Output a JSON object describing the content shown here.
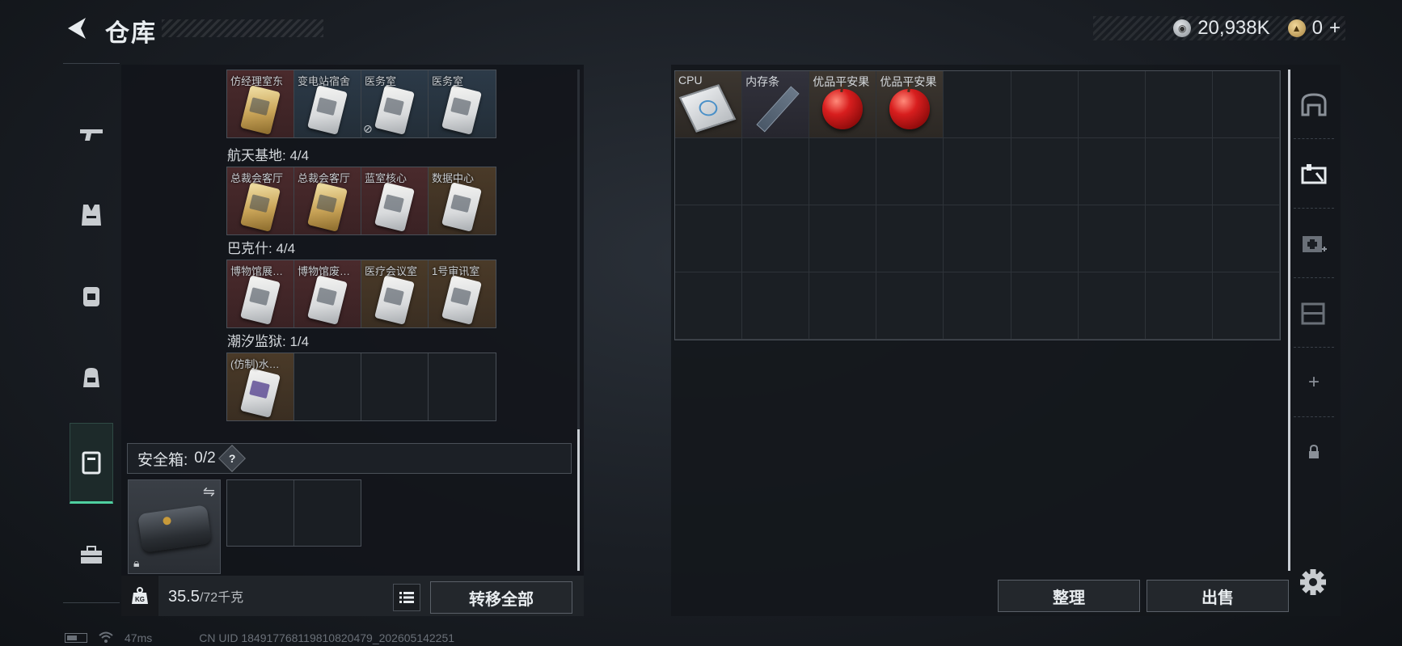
{
  "header": {
    "title": "仓库",
    "currencies": [
      {
        "icon": "silver-coin-icon",
        "value": "20,938K"
      },
      {
        "icon": "gold-coin-icon",
        "value": "0",
        "suffix": "+"
      }
    ]
  },
  "left_nav": [
    {
      "name": "weapon-icon",
      "active": false
    },
    {
      "name": "armor-vest-icon",
      "active": false
    },
    {
      "name": "chest-rig-icon",
      "active": false
    },
    {
      "name": "backpack-icon",
      "active": false
    },
    {
      "name": "safe-box-icon",
      "active": true
    },
    {
      "name": "toolbox-icon",
      "active": false
    }
  ],
  "key_groups": [
    {
      "label": "",
      "cells": [
        {
          "label": "仿经理室东",
          "color": "red",
          "card": "gold"
        },
        {
          "label": "变电站宿舍",
          "color": "blue",
          "card": "white"
        },
        {
          "label": "医务室",
          "color": "blue",
          "card": "white",
          "no_icon": true
        },
        {
          "label": "医务室",
          "color": "blue",
          "card": "white"
        }
      ]
    },
    {
      "label": "航天基地: 4/4",
      "cells": [
        {
          "label": "总裁会客厅",
          "color": "red",
          "card": "gold"
        },
        {
          "label": "总裁会客厅",
          "color": "red",
          "card": "gold"
        },
        {
          "label": "蓝室核心",
          "color": "red",
          "card": "white"
        },
        {
          "label": "数据中心",
          "color": "gold",
          "card": "white"
        }
      ]
    },
    {
      "label": "巴克什: 4/4",
      "cells": [
        {
          "label": "博物馆展…",
          "color": "red",
          "card": "white"
        },
        {
          "label": "博物馆废…",
          "color": "red",
          "card": "white"
        },
        {
          "label": "医疗会议室",
          "color": "gold",
          "card": "white"
        },
        {
          "label": "1号审讯室",
          "color": "gold",
          "card": "white"
        }
      ]
    },
    {
      "label": "潮汐监狱: 1/4",
      "cells": [
        {
          "label": "(仿制)水…",
          "color": "gold",
          "card": "purple"
        },
        {
          "label": "",
          "color": "empty"
        },
        {
          "label": "",
          "color": "empty"
        },
        {
          "label": "",
          "color": "empty"
        }
      ]
    }
  ],
  "safe_box": {
    "label": "安全箱:",
    "count": "0/2",
    "help": "?"
  },
  "weight": {
    "current": "35.5",
    "max": "/72千克"
  },
  "buttons": {
    "transfer_all": "转移全部",
    "sort": "整理",
    "sell": "出售"
  },
  "stash_items": [
    {
      "label": "CPU",
      "type": "cpu"
    },
    {
      "label": "内存条",
      "type": "ram"
    },
    {
      "label": "优品平安果",
      "type": "apple"
    },
    {
      "label": "优品平安果",
      "type": "apple"
    }
  ],
  "right_nav": [
    {
      "name": "stash-arch-icon"
    },
    {
      "name": "workbench-icon"
    },
    {
      "name": "medic-add-icon"
    },
    {
      "name": "storage-shelf-icon"
    },
    {
      "name": "add-icon",
      "text": "+"
    },
    {
      "name": "lock-icon"
    }
  ],
  "status": {
    "ping": "47ms",
    "uid": "CN UID 18491776811981082047​9_202605142251"
  }
}
